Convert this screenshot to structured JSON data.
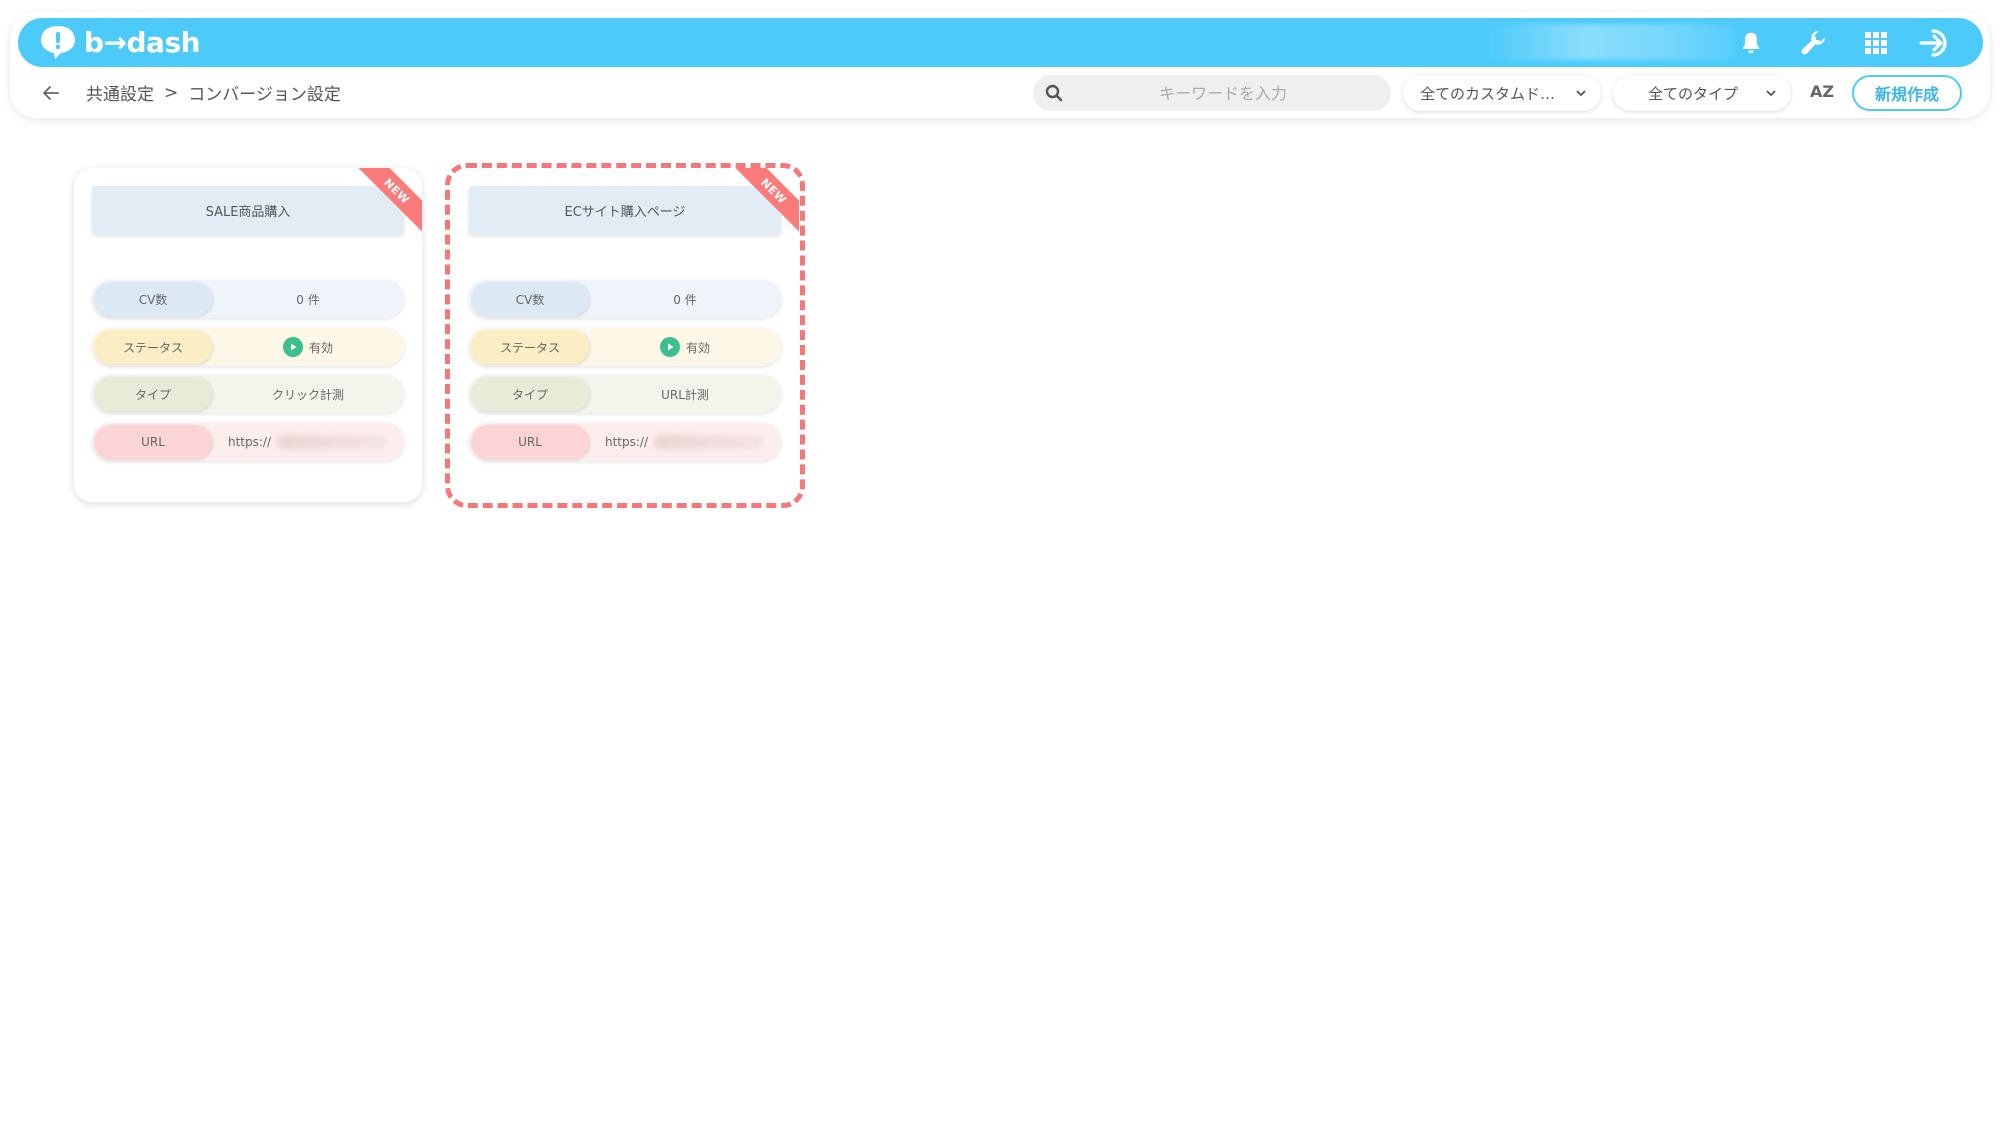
{
  "header": {
    "logo_text": "b→dash",
    "icons": [
      "bell-icon",
      "wrench-icon",
      "grid-icon",
      "logout-icon"
    ],
    "accent_color": "#4ccbfb"
  },
  "breadcrumb": {
    "parent": "共通設定",
    "separator": ">",
    "current": "コンバージョン設定"
  },
  "search": {
    "placeholder": "キーワードを入力"
  },
  "filters": {
    "custom_domain": "全てのカスタムド…",
    "type": "全てのタイプ"
  },
  "sort_label": "AZ",
  "new_button": "新規作成",
  "cards": [
    {
      "title": "SALE商品購入",
      "badge": "NEW",
      "cv_label": "CV数",
      "cv_value": "0 件",
      "status_label": "ステータス",
      "status_value": "有効",
      "type_label": "タイプ",
      "type_value": "クリック計測",
      "url_label": "URL",
      "url_value": "https://",
      "selected": false
    },
    {
      "title": "ECサイト購入ページ",
      "badge": "NEW",
      "cv_label": "CV数",
      "cv_value": "0 件",
      "status_label": "ステータス",
      "status_value": "有効",
      "type_label": "タイプ",
      "type_value": "URL計測",
      "url_label": "URL",
      "url_value": "https://",
      "selected": true
    }
  ]
}
